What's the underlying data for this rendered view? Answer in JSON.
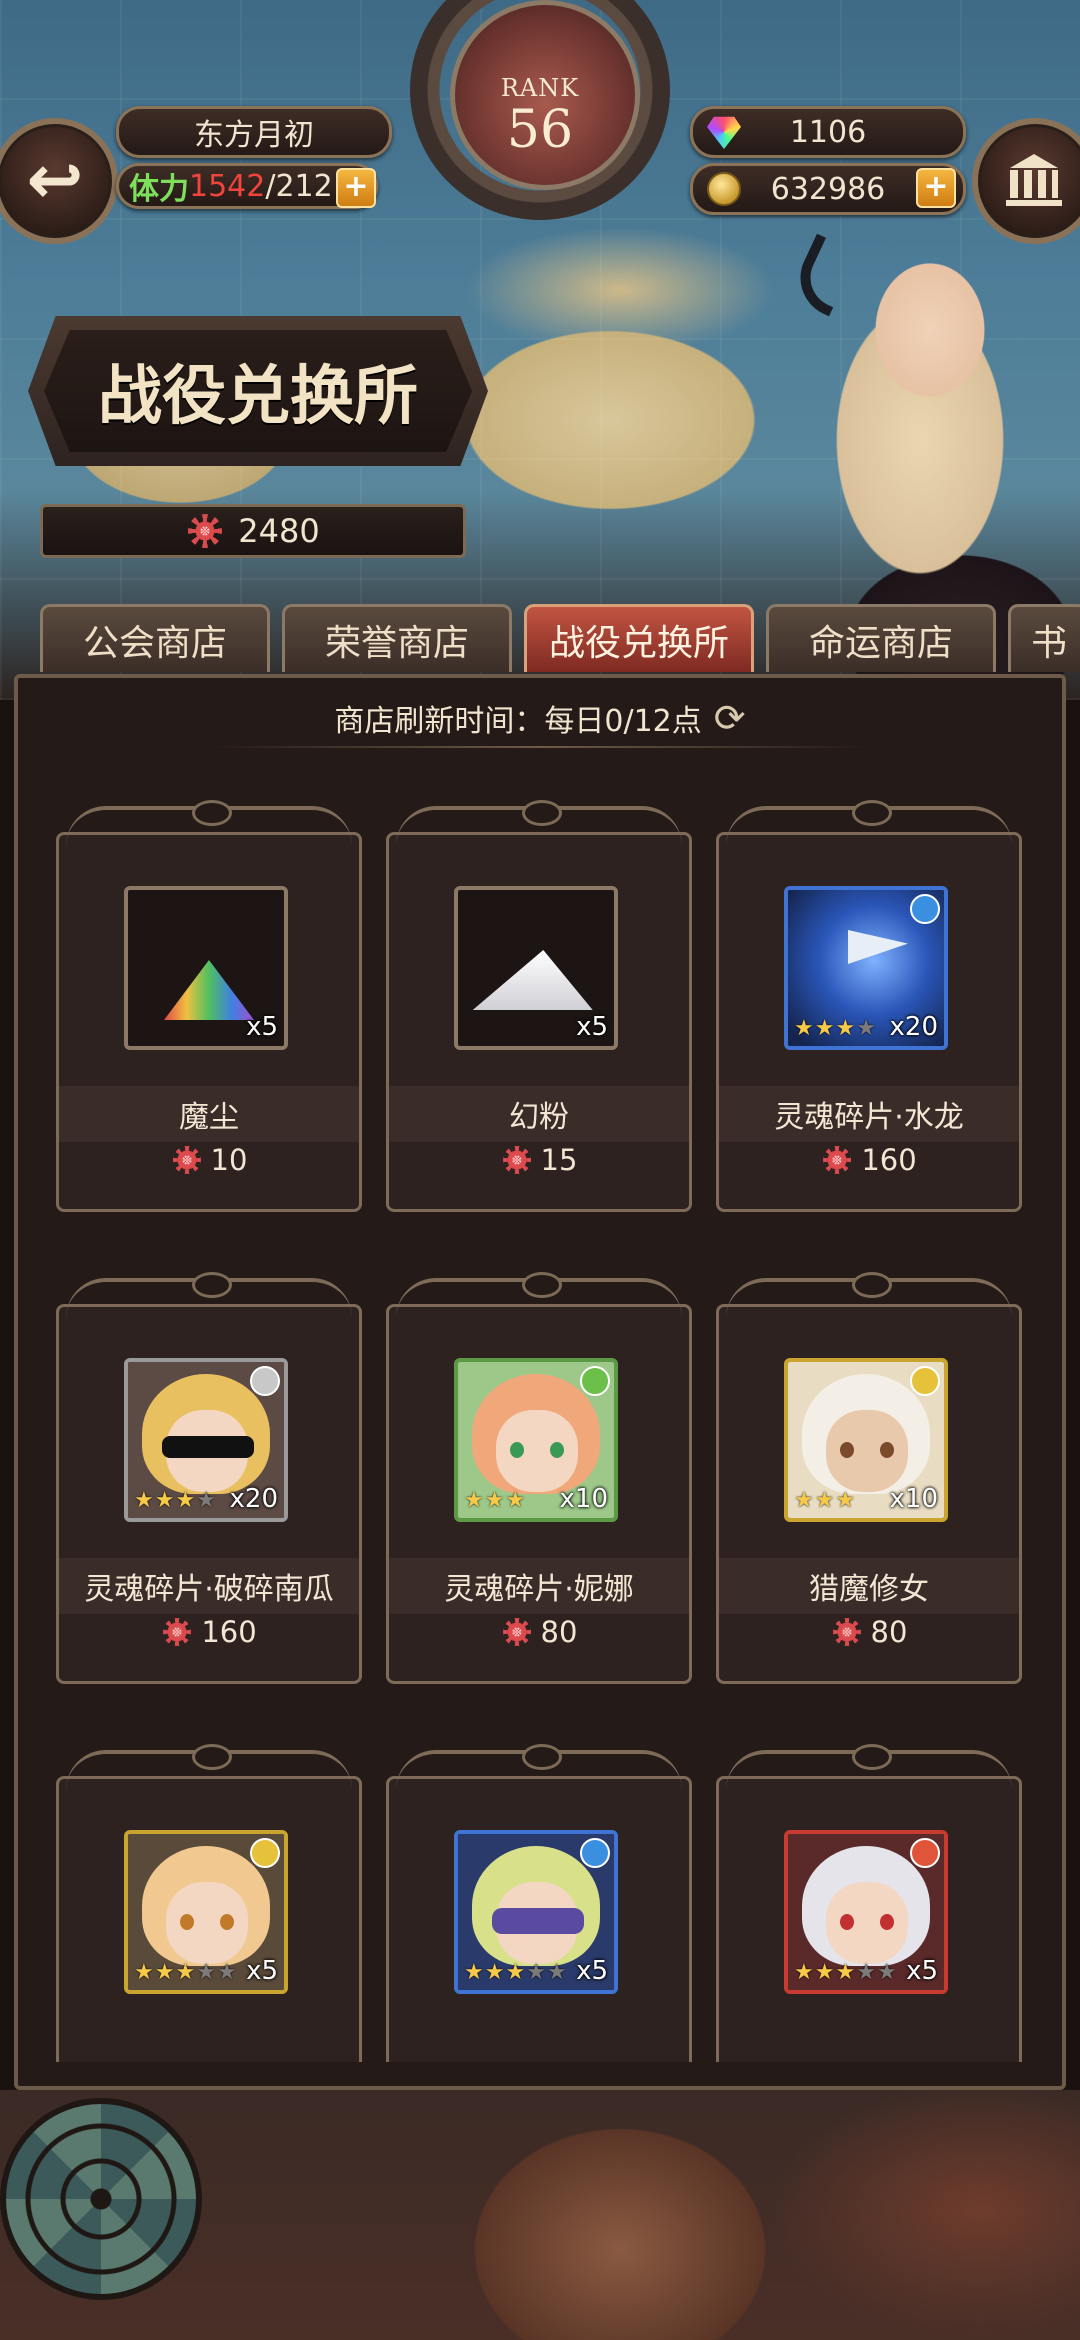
{
  "header": {
    "player_name": "东方月初",
    "stamina_label": "体力",
    "stamina_current": "1542",
    "stamina_max": "/212",
    "rank_label": "RANK",
    "rank_value": "56",
    "gems": "1106",
    "gold": "632986",
    "plus_symbol": "+",
    "back_symbol": "↩"
  },
  "shop": {
    "title": "战役兑换所",
    "currency_amount": "2480",
    "refresh_text": "商店刷新时间：每日0/12点",
    "refresh_icon": "⟳"
  },
  "tabs": [
    {
      "label": "公会商店",
      "active": false
    },
    {
      "label": "荣誉商店",
      "active": false
    },
    {
      "label": "战役兑换所",
      "active": true
    },
    {
      "label": "命运商店",
      "active": false
    },
    {
      "label": "书",
      "active": false
    }
  ],
  "items": [
    {
      "name": "魔尘",
      "price": "10",
      "qty": "x5",
      "kind": "rainbow-powder",
      "stars": 0
    },
    {
      "name": "幻粉",
      "price": "15",
      "qty": "x5",
      "kind": "white-powder",
      "stars": 0
    },
    {
      "name": "灵魂碎片·水龙",
      "price": "160",
      "qty": "x20",
      "kind": "water-dragon",
      "stars": 3,
      "max_stars": 4,
      "element": "water",
      "frame_color": "#3f74d4"
    },
    {
      "name": "灵魂碎片·破碎南瓜",
      "price": "160",
      "qty": "x20",
      "kind": "pumpkin",
      "stars": 3,
      "max_stars": 4,
      "element": "light",
      "frame_color": "#9a9a9a"
    },
    {
      "name": "灵魂碎片·妮娜",
      "price": "80",
      "qty": "x10",
      "kind": "nina",
      "stars": 3,
      "max_stars": 3,
      "element": "wind",
      "frame_color": "#5d9a45"
    },
    {
      "name": "猎魔修女",
      "price": "80",
      "qty": "x10",
      "kind": "nun",
      "stars": 3,
      "max_stars": 3,
      "element": "thunder",
      "frame_color": "#c9a530"
    },
    {
      "name": "",
      "price": "",
      "qty": "x5",
      "kind": "girl-thunder",
      "stars": 3,
      "max_stars": 5,
      "element": "thunder",
      "frame_color": "#c9a530"
    },
    {
      "name": "",
      "price": "",
      "qty": "x5",
      "kind": "girl-water",
      "stars": 3,
      "max_stars": 5,
      "element": "water",
      "frame_color": "#3f74d4"
    },
    {
      "name": "",
      "price": "",
      "qty": "x5",
      "kind": "girl-fire",
      "stars": 3,
      "max_stars": 5,
      "element": "fire",
      "frame_color": "#c93a30"
    }
  ]
}
